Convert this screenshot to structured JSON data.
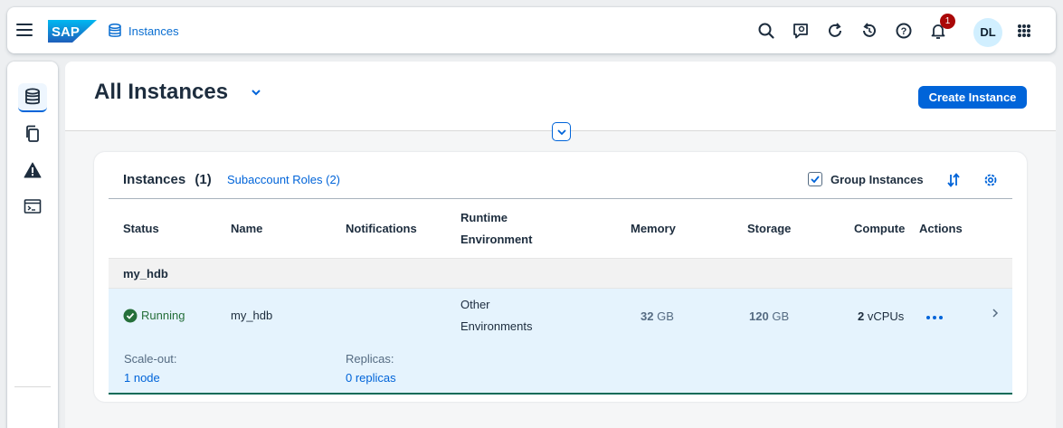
{
  "shell": {
    "logo_text": "SAP",
    "app_title": "Instances",
    "notification_count": "1",
    "user_initials": "DL",
    "icons": [
      "menu-icon",
      "search-icon",
      "feedback-icon",
      "refresh-icon",
      "history-icon",
      "help-icon",
      "bell-icon",
      "grid-icon"
    ]
  },
  "sidenav": {
    "items": [
      {
        "icon": "database-icon",
        "active": true
      },
      {
        "icon": "copy-icon",
        "active": false
      },
      {
        "icon": "alert-icon",
        "active": false
      },
      {
        "icon": "console-icon",
        "active": false
      }
    ]
  },
  "page": {
    "title": "All Instances",
    "create_button": "Create Instance"
  },
  "card": {
    "title": "Instances",
    "count": "(1)",
    "roles_link": "Subaccount Roles (2)",
    "group_checkbox_label": "Group Instances",
    "group_checked": true,
    "columns": {
      "status": "Status",
      "name": "Name",
      "notifications": "Notifications",
      "runtime_line1": "Runtime",
      "runtime_line2": "Environment",
      "memory": "Memory",
      "storage": "Storage",
      "compute": "Compute",
      "actions": "Actions"
    },
    "group": "my_hdb",
    "row": {
      "status": "Running",
      "name": "my_hdb",
      "runtime_line1": "Other",
      "runtime_line2": "Environments",
      "memory_value": "32",
      "memory_unit": "GB",
      "storage_value": "120",
      "storage_unit": "GB",
      "compute_value": "2",
      "compute_unit": "vCPUs",
      "scaleout_label": "Scale-out:",
      "scaleout_value": "1 node",
      "replicas_label": "Replicas:",
      "replicas_value": "0 replicas"
    }
  },
  "colors": {
    "accent": "#0064d9",
    "positive": "#256f3a",
    "badge": "#aa0808",
    "row_selected": "#e5f3fd"
  }
}
